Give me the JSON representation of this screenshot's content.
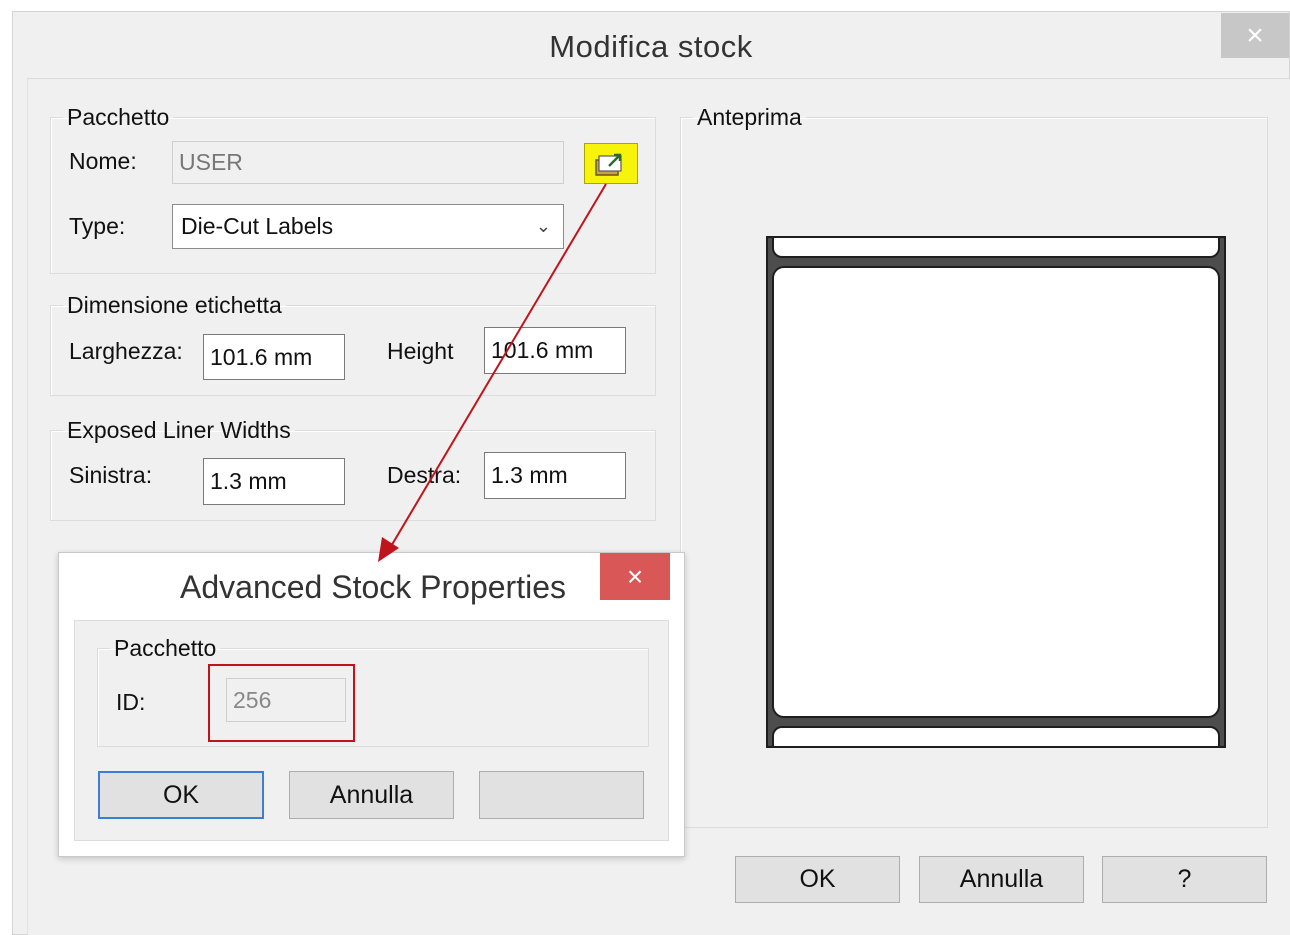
{
  "main_dialog": {
    "title": "Modifica stock",
    "close_glyph": "×",
    "package_group": {
      "legend": "Pacchetto",
      "name_label": "Nome:",
      "name_value": "USER",
      "type_label": "Type:",
      "type_value": "Die-Cut Labels",
      "advanced_button_icon": "advanced-properties-icon"
    },
    "dimension_group": {
      "legend": "Dimensione etichetta",
      "width_label": "Larghezza:",
      "width_value": "101.6 mm",
      "height_label": "Height",
      "height_value": "101.6 mm"
    },
    "liner_group": {
      "legend": "Exposed Liner Widths",
      "left_label": "Sinistra:",
      "left_value": "1.3 mm",
      "right_label": "Destra:",
      "right_value": "1.3 mm"
    },
    "preview_group": {
      "legend": "Anteprima"
    },
    "buttons": {
      "ok": "OK",
      "cancel": "Annulla",
      "help": "?"
    }
  },
  "advanced_dialog": {
    "title": "Advanced Stock Properties",
    "close_glyph": "×",
    "package_group": {
      "legend": "Pacchetto",
      "id_label": "ID:",
      "id_value": "256"
    },
    "buttons": {
      "ok": "OK",
      "cancel": "Annulla",
      "third": ""
    }
  },
  "annotation": {
    "arrow_color": "#c0141c",
    "highlight_color": "#c0141c",
    "icon_button_color": "#f7f30a"
  }
}
